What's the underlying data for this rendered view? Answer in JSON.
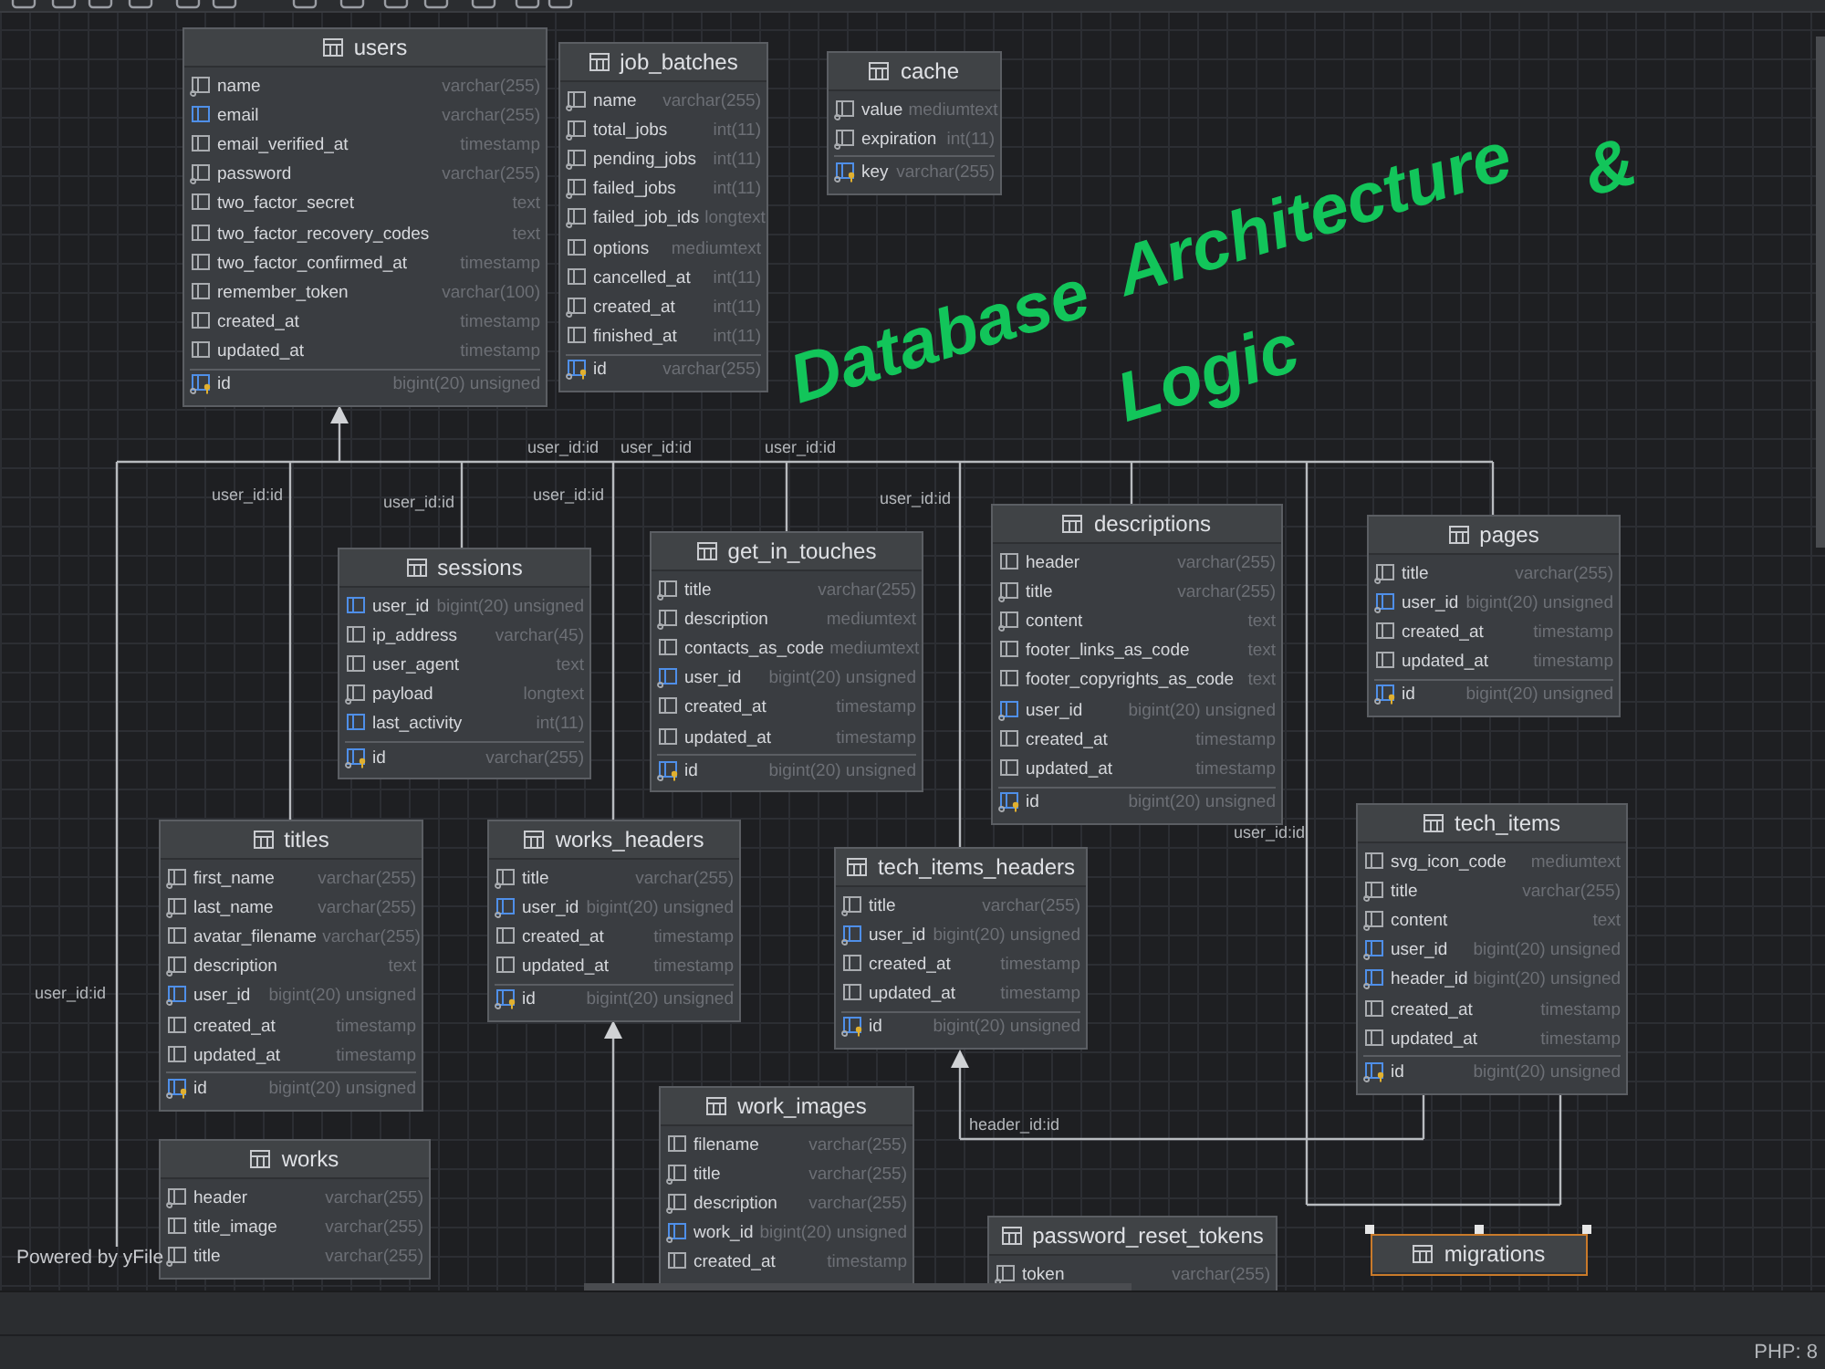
{
  "diagram": {
    "title_overlay": [
      "Database",
      "Architecture",
      "&",
      "Logic"
    ],
    "tables": [
      {
        "name": "users",
        "selected": false,
        "columns": [
          {
            "name": "name",
            "type": "varchar(255)",
            "kind": "required"
          },
          {
            "name": "email",
            "type": "varchar(255)",
            "kind": "indexed"
          },
          {
            "name": "email_verified_at",
            "type": "timestamp",
            "kind": "plain"
          },
          {
            "name": "password",
            "type": "varchar(255)",
            "kind": "required"
          },
          {
            "name": "two_factor_secret",
            "type": "text",
            "kind": "plain"
          },
          {
            "name": "two_factor_recovery_codes",
            "type": "text",
            "kind": "plain"
          },
          {
            "name": "two_factor_confirmed_at",
            "type": "timestamp",
            "kind": "plain"
          },
          {
            "name": "remember_token",
            "type": "varchar(100)",
            "kind": "plain"
          },
          {
            "name": "created_at",
            "type": "timestamp",
            "kind": "plain"
          },
          {
            "name": "updated_at",
            "type": "timestamp",
            "kind": "plain"
          },
          {
            "name": "id",
            "type": "bigint(20) unsigned",
            "kind": "primary"
          }
        ]
      },
      {
        "name": "job_batches",
        "selected": false,
        "columns": [
          {
            "name": "name",
            "type": "varchar(255)",
            "kind": "required"
          },
          {
            "name": "total_jobs",
            "type": "int(11)",
            "kind": "required"
          },
          {
            "name": "pending_jobs",
            "type": "int(11)",
            "kind": "required"
          },
          {
            "name": "failed_jobs",
            "type": "int(11)",
            "kind": "required"
          },
          {
            "name": "failed_job_ids",
            "type": "longtext",
            "kind": "required"
          },
          {
            "name": "options",
            "type": "mediumtext",
            "kind": "plain"
          },
          {
            "name": "cancelled_at",
            "type": "int(11)",
            "kind": "plain"
          },
          {
            "name": "created_at",
            "type": "int(11)",
            "kind": "required"
          },
          {
            "name": "finished_at",
            "type": "int(11)",
            "kind": "plain"
          },
          {
            "name": "id",
            "type": "varchar(255)",
            "kind": "primary"
          }
        ]
      },
      {
        "name": "cache",
        "selected": false,
        "columns": [
          {
            "name": "value",
            "type": "mediumtext",
            "kind": "required"
          },
          {
            "name": "expiration",
            "type": "int(11)",
            "kind": "required"
          },
          {
            "name": "key",
            "type": "varchar(255)",
            "kind": "primary"
          }
        ]
      },
      {
        "name": "sessions",
        "selected": false,
        "columns": [
          {
            "name": "user_id",
            "type": "bigint(20) unsigned",
            "kind": "indexed"
          },
          {
            "name": "ip_address",
            "type": "varchar(45)",
            "kind": "plain"
          },
          {
            "name": "user_agent",
            "type": "text",
            "kind": "plain"
          },
          {
            "name": "payload",
            "type": "longtext",
            "kind": "required"
          },
          {
            "name": "last_activity",
            "type": "int(11)",
            "kind": "indexed"
          },
          {
            "name": "id",
            "type": "varchar(255)",
            "kind": "primary"
          }
        ]
      },
      {
        "name": "get_in_touches",
        "selected": false,
        "columns": [
          {
            "name": "title",
            "type": "varchar(255)",
            "kind": "required"
          },
          {
            "name": "description",
            "type": "mediumtext",
            "kind": "required"
          },
          {
            "name": "contacts_as_code",
            "type": "mediumtext",
            "kind": "plain"
          },
          {
            "name": "user_id",
            "type": "bigint(20) unsigned",
            "kind": "foreign"
          },
          {
            "name": "created_at",
            "type": "timestamp",
            "kind": "plain"
          },
          {
            "name": "updated_at",
            "type": "timestamp",
            "kind": "plain"
          },
          {
            "name": "id",
            "type": "bigint(20) unsigned",
            "kind": "primary"
          }
        ]
      },
      {
        "name": "descriptions",
        "selected": false,
        "columns": [
          {
            "name": "header",
            "type": "varchar(255)",
            "kind": "plain"
          },
          {
            "name": "title",
            "type": "varchar(255)",
            "kind": "required"
          },
          {
            "name": "content",
            "type": "text",
            "kind": "required"
          },
          {
            "name": "footer_links_as_code",
            "type": "text",
            "kind": "plain"
          },
          {
            "name": "footer_copyrights_as_code",
            "type": "text",
            "kind": "plain"
          },
          {
            "name": "user_id",
            "type": "bigint(20) unsigned",
            "kind": "foreign"
          },
          {
            "name": "created_at",
            "type": "timestamp",
            "kind": "plain"
          },
          {
            "name": "updated_at",
            "type": "timestamp",
            "kind": "plain"
          },
          {
            "name": "id",
            "type": "bigint(20) unsigned",
            "kind": "primary"
          }
        ]
      },
      {
        "name": "pages",
        "selected": false,
        "columns": [
          {
            "name": "title",
            "type": "varchar(255)",
            "kind": "required"
          },
          {
            "name": "user_id",
            "type": "bigint(20) unsigned",
            "kind": "foreign"
          },
          {
            "name": "created_at",
            "type": "timestamp",
            "kind": "plain"
          },
          {
            "name": "updated_at",
            "type": "timestamp",
            "kind": "plain"
          },
          {
            "name": "id",
            "type": "bigint(20) unsigned",
            "kind": "primary"
          }
        ]
      },
      {
        "name": "titles",
        "selected": false,
        "columns": [
          {
            "name": "first_name",
            "type": "varchar(255)",
            "kind": "required"
          },
          {
            "name": "last_name",
            "type": "varchar(255)",
            "kind": "required"
          },
          {
            "name": "avatar_filename",
            "type": "varchar(255)",
            "kind": "plain"
          },
          {
            "name": "description",
            "type": "text",
            "kind": "required"
          },
          {
            "name": "user_id",
            "type": "bigint(20) unsigned",
            "kind": "foreign"
          },
          {
            "name": "created_at",
            "type": "timestamp",
            "kind": "plain"
          },
          {
            "name": "updated_at",
            "type": "timestamp",
            "kind": "plain"
          },
          {
            "name": "id",
            "type": "bigint(20) unsigned",
            "kind": "primary"
          }
        ]
      },
      {
        "name": "works_headers",
        "selected": false,
        "columns": [
          {
            "name": "title",
            "type": "varchar(255)",
            "kind": "required"
          },
          {
            "name": "user_id",
            "type": "bigint(20) unsigned",
            "kind": "foreign"
          },
          {
            "name": "created_at",
            "type": "timestamp",
            "kind": "plain"
          },
          {
            "name": "updated_at",
            "type": "timestamp",
            "kind": "plain"
          },
          {
            "name": "id",
            "type": "bigint(20) unsigned",
            "kind": "primary"
          }
        ]
      },
      {
        "name": "tech_items_headers",
        "selected": false,
        "columns": [
          {
            "name": "title",
            "type": "varchar(255)",
            "kind": "required"
          },
          {
            "name": "user_id",
            "type": "bigint(20) unsigned",
            "kind": "foreign"
          },
          {
            "name": "created_at",
            "type": "timestamp",
            "kind": "plain"
          },
          {
            "name": "updated_at",
            "type": "timestamp",
            "kind": "plain"
          },
          {
            "name": "id",
            "type": "bigint(20) unsigned",
            "kind": "primary"
          }
        ]
      },
      {
        "name": "tech_items",
        "selected": false,
        "columns": [
          {
            "name": "svg_icon_code",
            "type": "mediumtext",
            "kind": "plain"
          },
          {
            "name": "title",
            "type": "varchar(255)",
            "kind": "required"
          },
          {
            "name": "content",
            "type": "text",
            "kind": "required"
          },
          {
            "name": "user_id",
            "type": "bigint(20) unsigned",
            "kind": "foreign"
          },
          {
            "name": "header_id",
            "type": "bigint(20) unsigned",
            "kind": "foreign"
          },
          {
            "name": "created_at",
            "type": "timestamp",
            "kind": "plain"
          },
          {
            "name": "updated_at",
            "type": "timestamp",
            "kind": "plain"
          },
          {
            "name": "id",
            "type": "bigint(20) unsigned",
            "kind": "primary"
          }
        ]
      },
      {
        "name": "works",
        "selected": false,
        "columns": [
          {
            "name": "header",
            "type": "varchar(255)",
            "kind": "required"
          },
          {
            "name": "title_image",
            "type": "varchar(255)",
            "kind": "plain"
          },
          {
            "name": "title",
            "type": "varchar(255)",
            "kind": "required"
          }
        ]
      },
      {
        "name": "work_images",
        "selected": false,
        "columns": [
          {
            "name": "filename",
            "type": "varchar(255)",
            "kind": "plain"
          },
          {
            "name": "title",
            "type": "varchar(255)",
            "kind": "required"
          },
          {
            "name": "description",
            "type": "varchar(255)",
            "kind": "required"
          },
          {
            "name": "work_id",
            "type": "bigint(20) unsigned",
            "kind": "foreign"
          },
          {
            "name": "created_at",
            "type": "timestamp",
            "kind": "plain"
          }
        ]
      },
      {
        "name": "password_reset_tokens",
        "selected": false,
        "columns": [
          {
            "name": "token",
            "type": "varchar(255)",
            "kind": "required"
          }
        ]
      },
      {
        "name": "migrations",
        "selected": true
      }
    ],
    "relation_labels": [
      "user_id:id",
      "user_id:id",
      "user_id:id",
      "user_id:id",
      "user_id:id",
      "user_id:id",
      "user_id:id",
      "user_id:id",
      "user_id:id",
      "header_id:id"
    ],
    "credit": "Powered by yFile"
  },
  "status_bar": {
    "php": "PHP: 8"
  }
}
